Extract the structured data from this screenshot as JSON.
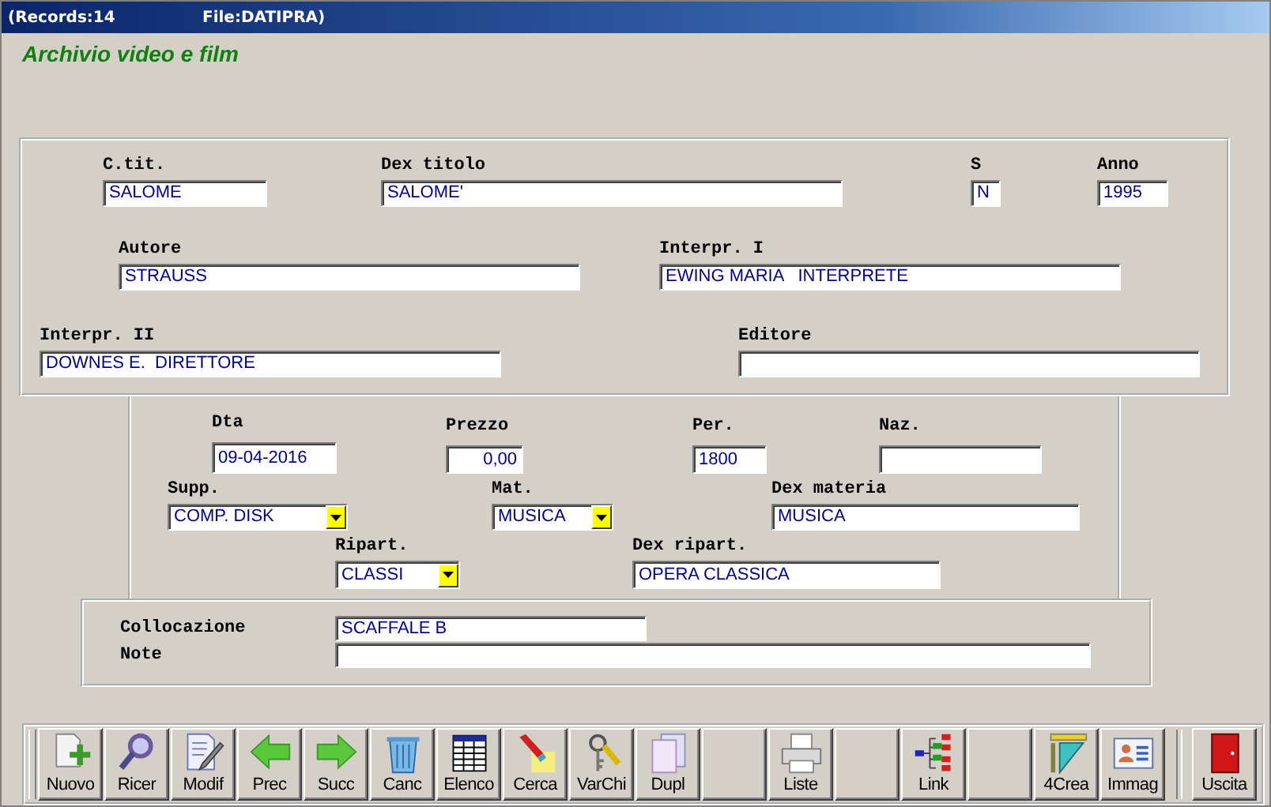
{
  "window": {
    "records": "(Records:14",
    "file": "File:DATIPRA)"
  },
  "heading": "Archivio video e film",
  "panels": [
    {
      "kind": "stacked",
      "rows": [
        [
          {
            "label": "C.tit.",
            "value": "SALOME",
            "kind": "text"
          },
          {
            "label": "Dex titolo",
            "value": "SALOME'",
            "kind": "text"
          },
          {
            "label": "S",
            "value": "N",
            "kind": "text"
          },
          {
            "label": "Anno",
            "value": "1995",
            "kind": "text"
          }
        ],
        [
          {
            "label": "Autore",
            "value": "STRAUSS",
            "kind": "text"
          },
          {
            "label": "Interpr. I",
            "value": "EWING MARIA   INTERPRETE",
            "kind": "text"
          }
        ],
        [
          {
            "label": "Interpr. II",
            "value": "DOWNES E.  DIRETTORE",
            "kind": "text"
          },
          {
            "label": "Editore",
            "kind": "text"
          }
        ]
      ]
    },
    {
      "kind": "stacked",
      "rows": [
        [
          {
            "label": "Dta",
            "value": "09-04-2016",
            "kind": "text"
          },
          {
            "label": "Prezzo",
            "value": "0,00",
            "kind": "number"
          },
          {
            "label": "Per.",
            "value": "1800",
            "kind": "text"
          },
          {
            "label": "Naz.",
            "kind": "text"
          }
        ],
        [
          {
            "label": "Supp.",
            "value": "COMP. DISK",
            "kind": "combo"
          },
          {
            "label": "Mat.",
            "value": "MUSICA",
            "kind": "combo"
          },
          {
            "label": "Dex materia",
            "value": "MUSICA",
            "kind": "text"
          }
        ],
        [
          {
            "label": "Ripart.",
            "value": "CLASSI",
            "kind": "combo"
          },
          {
            "label": "Dex ripart.",
            "value": "OPERA CLASSICA",
            "kind": "text"
          }
        ]
      ]
    },
    {
      "kind": "inline",
      "rows": [
        [
          {
            "label": "Collocazione",
            "value": "SCAFFALE B",
            "kind": "text"
          }
        ],
        [
          {
            "label": "Note",
            "kind": "text"
          }
        ]
      ]
    }
  ],
  "toolbar": [
    {
      "kind": "button",
      "label": "Nuovo"
    },
    {
      "kind": "button",
      "label": "Ricer"
    },
    {
      "kind": "button",
      "label": "Modif"
    },
    {
      "kind": "button",
      "label": "Prec"
    },
    {
      "kind": "button",
      "label": "Succ"
    },
    {
      "kind": "button",
      "label": "Canc"
    },
    {
      "kind": "button",
      "label": "Elenco"
    },
    {
      "kind": "button",
      "label": "Cerca"
    },
    {
      "kind": "button",
      "label": "VarChi"
    },
    {
      "kind": "button",
      "label": "Dupl"
    },
    {
      "kind": "blank"
    },
    {
      "kind": "button",
      "label": "Liste"
    },
    {
      "kind": "blank"
    },
    {
      "kind": "button",
      "label": "Link"
    },
    {
      "kind": "blank"
    },
    {
      "kind": "button",
      "label": "4Crea"
    },
    {
      "kind": "button",
      "label": "Immag"
    },
    {
      "kind": "separator"
    },
    {
      "kind": "button",
      "label": "Uscita"
    }
  ]
}
